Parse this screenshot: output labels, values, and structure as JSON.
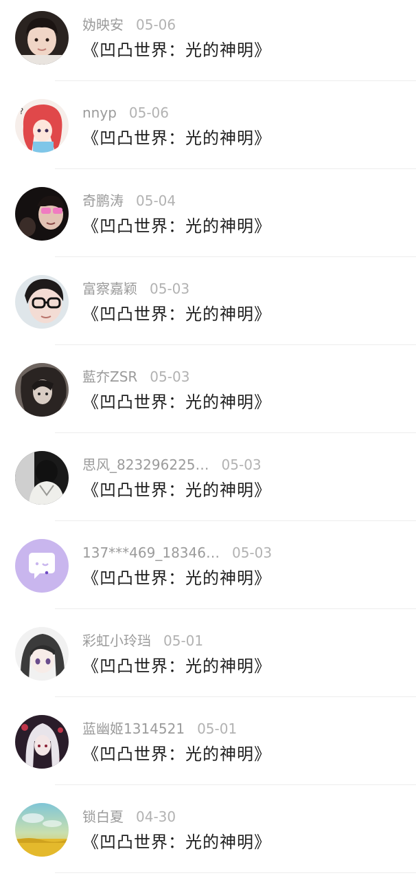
{
  "messages": [
    {
      "name": "妫映安",
      "date": "05-06",
      "text": "《凹凸世界：光的神明》",
      "avatar": "photo-baby"
    },
    {
      "name": "nnyp",
      "date": "05-06",
      "text": "《凹凸世界：光的神明》",
      "avatar": "anime-red-hair"
    },
    {
      "name": "奇鹏涛",
      "date": "05-04",
      "text": "《凹凸世界：光的神明》",
      "avatar": "photo-pink-glasses"
    },
    {
      "name": "富察嘉颖",
      "date": "05-03",
      "text": "《凹凸世界：光的神明》",
      "avatar": "photo-glasses"
    },
    {
      "name": "藍夰ZSR",
      "date": "05-03",
      "text": "《凹凸世界：光的神明》",
      "avatar": "anime-dark"
    },
    {
      "name": "思风_823296225…",
      "date": "05-03",
      "text": "《凹凸世界：光的神明》",
      "avatar": "photo-hoodie"
    },
    {
      "name": "137***469_18346…",
      "date": "05-03",
      "text": "《凹凸世界：光的神明》",
      "avatar": "default-chat"
    },
    {
      "name": "彩虹小玲珰",
      "date": "05-01",
      "text": "《凹凸世界：光的神明》",
      "avatar": "anime-girl-gray"
    },
    {
      "name": "蓝幽姬1314521",
      "date": "05-01",
      "text": "《凹凸世界：光的神明》",
      "avatar": "anime-white-hair"
    },
    {
      "name": "锁白夏",
      "date": "04-30",
      "text": "《凹凸世界：光的神明》",
      "avatar": "landscape-sky"
    }
  ],
  "colors": {
    "name": "#9b9b9b",
    "date": "#b2b2b2",
    "text": "#1e1e1e",
    "default_avatar": "#c9b6ee"
  }
}
